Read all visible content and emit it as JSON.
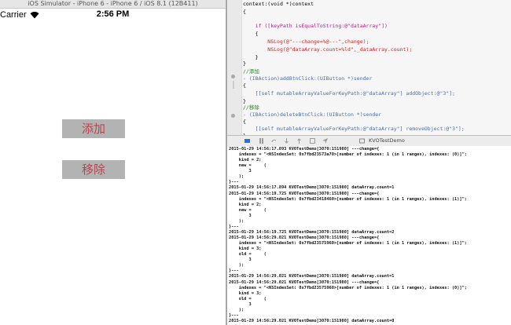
{
  "simulator": {
    "window_title": "iOS Simulator - iPhone 6 - iPhone 6 / iOS 8.1 (12B411)",
    "status": {
      "carrier": "Carrier",
      "time": "2:56 PM"
    },
    "buttons": {
      "add_label": "添加",
      "remove_label": "移除"
    }
  },
  "editor": {
    "code_lines": [
      "context:(void *)context",
      "{",
      "",
      "    if ([keyPath isEqualToString:@\"dataArray\"])",
      "    {",
      "        NSLog(@\"---change=%@---\",change);",
      "        NSLog(@\"dataArray.count=%ld\",_dataArray.count);",
      "    }",
      "",
      "}",
      "",
      "//添加",
      "- (IBAction)addBtnClick:(UIButton *)sender",
      "{",
      "    [[self mutableArrayValueForKeyPath:@\"dataArray\"] addObject:@\"3\"];",
      "}",
      "//移除",
      "- (IBAction)deleteBtnClick:(UIButton *)sender",
      "{",
      "    [[self mutableArrayValueForKeyPath:@\"dataArray\"] removeObject:@\"3\"];",
      "}"
    ]
  },
  "debug_bar": {
    "icons": [
      "console-toggle-icon",
      "pause-icon",
      "step-over-icon",
      "step-in-icon",
      "step-out-icon",
      "view-debug-icon",
      "location-icon",
      "target-icon"
    ],
    "process_label": "KVOTestDemo"
  },
  "console": {
    "lines": [
      "2015-01-29 14:56:17.893 KVOTestDemo[3070:151980] ---change={",
      "    indexes = \"<NSIndexSet: 0x7fbd23573a70>[number of indexes: 1 (in 1 ranges), indexes: (0)]\";",
      "    kind = 2;",
      "    new =     (",
      "        3",
      "    );",
      "}---",
      "2015-01-29 14:56:17.894 KVOTestDemo[3070:151980] dataArray.count=1",
      "2015-01-29 14:56:19.725 KVOTestDemo[3070:151980] ---change={",
      "    indexes = \"<NSIndexSet: 0x7fbd23418460>[number of indexes: 1 (in 1 ranges), indexes: (1)]\";",
      "    kind = 2;",
      "    new =     (",
      "        3",
      "    );",
      "}---",
      "2015-01-29 14:56:19.725 KVOTestDemo[3070:151980] dataArray.count=2",
      "2015-01-29 14:56:29.021 KVOTestDemo[3070:151980] ---change={",
      "    indexes = \"<NSIndexSet: 0x7fbd23575960>[number of indexes: 1 (in 1 ranges), indexes: (1)]\";",
      "    kind = 3;",
      "    old =     (",
      "        3",
      "    );",
      "}---",
      "2015-01-29 14:56:29.021 KVOTestDemo[3070:151980] dataArray.count=1",
      "2015-01-29 14:56:29.021 KVOTestDemo[3070:151980] ---change={",
      "    indexes = \"<NSIndexSet: 0x7fbd23575960>[number of indexes: 1 (in 1 ranges), indexes: (0)]\";",
      "    kind = 3;",
      "    old =     (",
      "        3",
      "    );",
      "}---",
      "2015-01-29 14:56:29.021 KVOTestDemo[3070:151980] dataArray.count=0"
    ]
  }
}
